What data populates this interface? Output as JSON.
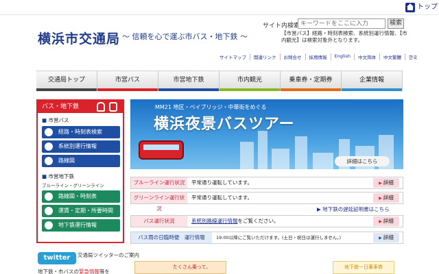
{
  "top_link": "トップ",
  "header": {
    "logo": "横浜市交通局",
    "tagline": "～ 信頼を心で運ぶ市バス・地下鉄 ～"
  },
  "search": {
    "label": "サイト内検索",
    "placeholder": "キーワードをここに入力",
    "button": "検索",
    "note": "【市営バス】経路・時刻表検索、系統別運行情報、【市内観光】は検索対象外となります。"
  },
  "utility_links": [
    "サイトマップ",
    "関連リンク",
    "お問合せ",
    "採用情報",
    "English",
    "中文简体",
    "中文繁體",
    "한국"
  ],
  "nav": [
    {
      "label": "交通局トップ",
      "color": "#444444"
    },
    {
      "label": "市営バス",
      "color": "#d9222a"
    },
    {
      "label": "市営地下鉄",
      "color": "#1f4fa3"
    },
    {
      "label": "市内観光",
      "color": "#8ab820"
    },
    {
      "label": "乗車券・定期券",
      "color": "#e36c1a"
    },
    {
      "label": "企業情報",
      "color": "#2f8fd0"
    }
  ],
  "sidebar": {
    "title": "バス・地下鉄",
    "bus_section": "市営バス",
    "bus_links": [
      "経路・時刻表検索",
      "系統別運行情報",
      "路線図"
    ],
    "subway_section": "市営地下鉄",
    "subway_sub": "ブルーライン・グリーンライン",
    "subway_links": [
      "路線図・時刻表",
      "運賃・定期・所要時間",
      "地下鉄運行情報"
    ]
  },
  "twitter": {
    "badge": "twitter",
    "text": "交通局ツイッターのご案内"
  },
  "bottom_link": {
    "prefix": "地下鉄・市バスの",
    "em": "緊急情報",
    "suffix": "等を"
  },
  "banner": {
    "subtitle": "MM21 地区・ベイブリッジ・中華街をめぐる",
    "title": "横浜夜景バスツアー",
    "more": "詳細はこちら"
  },
  "status_rows": [
    {
      "label": "ブルーライン運行状況",
      "message": "平常通り運転しています。",
      "detail": "詳細",
      "style": "pink"
    },
    {
      "label": "グリーンライン運行状況",
      "message": "平常通り運転しています。",
      "detail": "詳細",
      "style": "pink"
    },
    {
      "label": "バス運行状況",
      "link": "系統別路線運行情報",
      "message": "をご覧ください。",
      "detail": "詳細",
      "style": "pink"
    },
    {
      "label": "バス雨の日臨時便　運行情報",
      "message": "19:00以降にご覧いただけます。(土日・祝日は運行しません。)",
      "detail": "詳細",
      "style": "blue"
    }
  ],
  "subway_delay_link": "▶ 地下鉄の遅延証明書はこちら",
  "bottom_banner": {
    "text": "たくさん乗って、",
    "right": "地下鉄一日乗車券"
  }
}
